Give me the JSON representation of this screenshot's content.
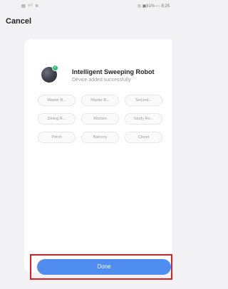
{
  "status_bar": {
    "left": "▤ ᵃˡˡ ≋",
    "right": "◎ ▣81% ▭ 8:25"
  },
  "header": {
    "cancel_label": "Cancel"
  },
  "device": {
    "name": "Intelligent Sweeping Robot",
    "status": "Device added successfully",
    "badge": "✓"
  },
  "rooms": [
    "Master B...",
    "Master B...",
    "Second...",
    "Dining R...",
    "Kitchen",
    "Study Ro...",
    "Porch",
    "Balcony",
    "Closet"
  ],
  "footer": {
    "done_label": "Done"
  },
  "colors": {
    "accent": "#4f8ef0",
    "highlight": "#e02020",
    "success": "#2bbf6a"
  }
}
